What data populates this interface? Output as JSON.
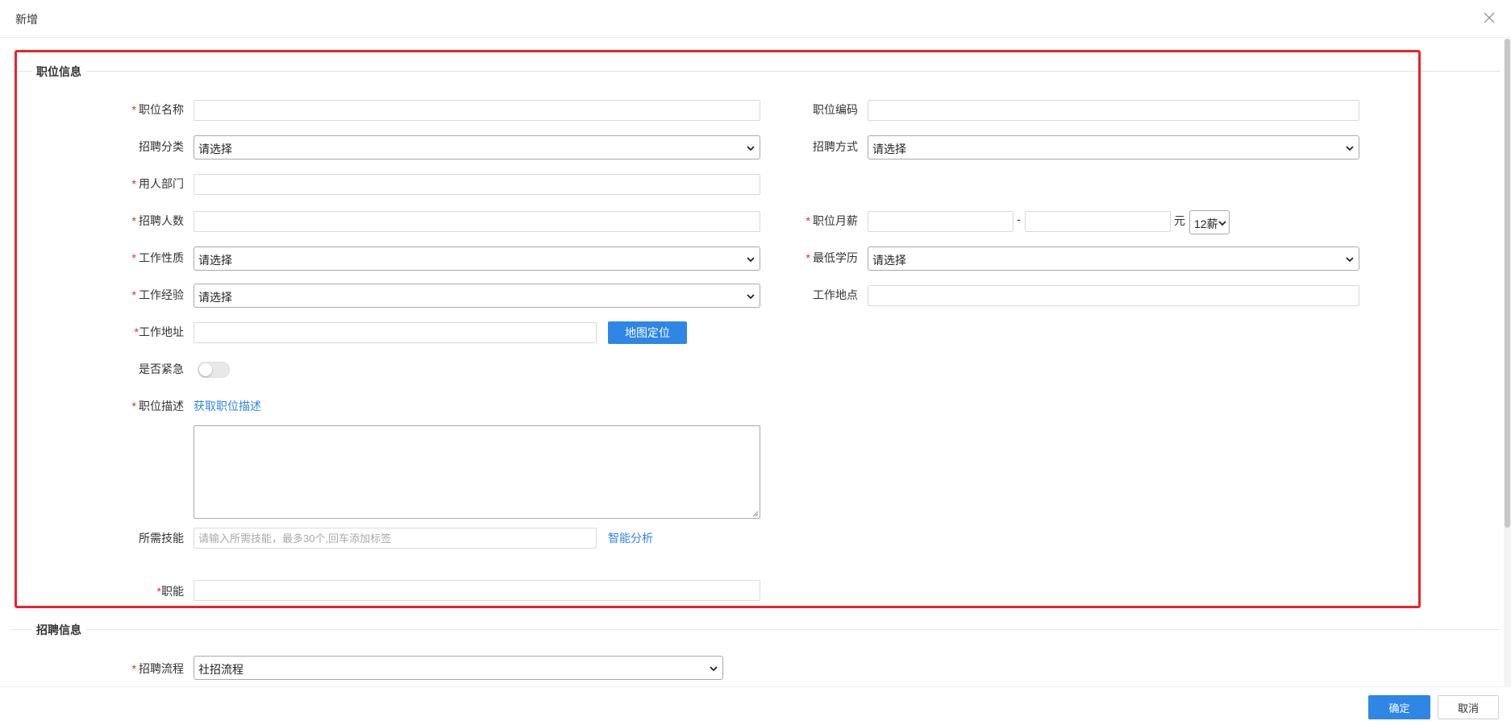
{
  "dialog": {
    "title": "新增",
    "close_icon": "close-icon"
  },
  "section_job": {
    "title": "职位信息"
  },
  "section_recruit": {
    "title": "招聘信息"
  },
  "fields": {
    "job_name": {
      "label": "职位名称",
      "required": true,
      "value": ""
    },
    "job_code": {
      "label": "职位编码",
      "required": false,
      "value": ""
    },
    "recruit_category": {
      "label": "招聘分类",
      "required": false,
      "value": "请选择"
    },
    "recruit_method": {
      "label": "招聘方式",
      "required": false,
      "value": "请选择"
    },
    "department": {
      "label": "用人部门",
      "required": true,
      "value": ""
    },
    "headcount": {
      "label": "招聘人数",
      "required": true,
      "value": ""
    },
    "salary": {
      "label": "职位月薪",
      "required": true,
      "min": "",
      "max": "",
      "dash": "-",
      "unit": "元",
      "months": "12薪"
    },
    "work_nature": {
      "label": "工作性质",
      "required": true,
      "value": "请选择"
    },
    "education": {
      "label": "最低学历",
      "required": true,
      "value": "请选择"
    },
    "experience": {
      "label": "工作经验",
      "required": true,
      "value": "请选择"
    },
    "work_location": {
      "label": "工作地点",
      "required": false,
      "value": ""
    },
    "work_address": {
      "label": "工作地址",
      "required": true,
      "value": "",
      "map_button": "地图定位"
    },
    "urgent": {
      "label": "是否紧急",
      "on": false
    },
    "description": {
      "label": "职位描述",
      "required": true,
      "fetch_link": "获取职位描述",
      "value": ""
    },
    "skills": {
      "label": "所需技能",
      "placeholder": "请输入所需技能，最多30个,回车添加标签",
      "analyze_link": "智能分析"
    },
    "function": {
      "label": "职能",
      "required": true,
      "value": ""
    },
    "recruit_process": {
      "label": "招聘流程",
      "required": true,
      "value": "社招流程"
    }
  },
  "footer": {
    "confirm": "确定",
    "cancel": "取消"
  },
  "colors": {
    "primary": "#2e86e6",
    "required": "#e8232b",
    "highlight": "#e8232b"
  }
}
